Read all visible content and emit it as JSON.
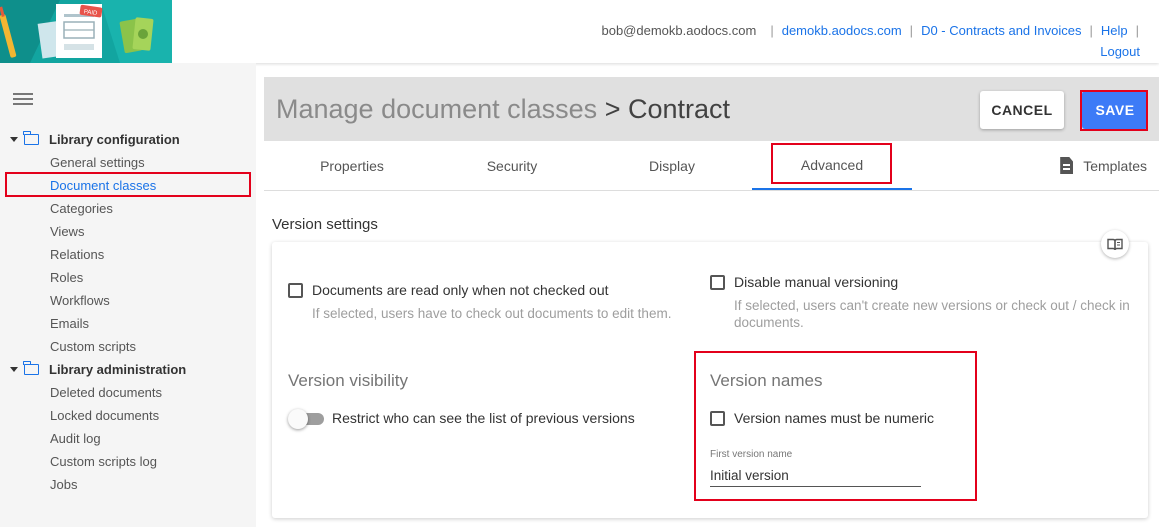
{
  "header": {
    "user_email": "bob@demokb.aodocs.com",
    "domain_link": "demokb.aodocs.com",
    "library_link": "D0 - Contracts and Invoices",
    "help_link": "Help",
    "logout_link": "Logout"
  },
  "sidebar": {
    "sections": [
      {
        "title": "Library configuration",
        "items": [
          "General settings",
          "Document classes",
          "Categories",
          "Views",
          "Relations",
          "Roles",
          "Workflows",
          "Emails",
          "Custom scripts"
        ]
      },
      {
        "title": "Library administration",
        "items": [
          "Deleted documents",
          "Locked documents",
          "Audit log",
          "Custom scripts log",
          "Jobs"
        ]
      }
    ],
    "active_item": "Document classes"
  },
  "page": {
    "title": "Manage document classes",
    "crumb": "> Contract",
    "cancel_label": "CANCEL",
    "save_label": "SAVE"
  },
  "tabs": {
    "items": [
      "Properties",
      "Security",
      "Display",
      "Advanced"
    ],
    "active": "Advanced",
    "templates_label": "Templates"
  },
  "version_settings": {
    "section_title": "Version settings",
    "read_only": {
      "label": "Documents are read only when not checked out",
      "help": "If selected, users have to check out documents to edit them.",
      "checked": false
    },
    "disable_manual": {
      "label": "Disable manual versioning",
      "help": "If selected, users can't create new versions or check out / check in documents.",
      "checked": false
    },
    "visibility": {
      "title": "Version visibility",
      "toggle_label": "Restrict who can see the list of previous versions",
      "enabled": false
    },
    "names": {
      "title": "Version names",
      "numeric_label": "Version names must be numeric",
      "numeric_checked": false,
      "first_version_label": "First version name",
      "first_version_value": "Initial version"
    }
  },
  "colors": {
    "accent": "#1a73e8",
    "save_button": "#3d7bf7",
    "highlight": "#e3001b",
    "logo_bg": "#12a5a0"
  }
}
